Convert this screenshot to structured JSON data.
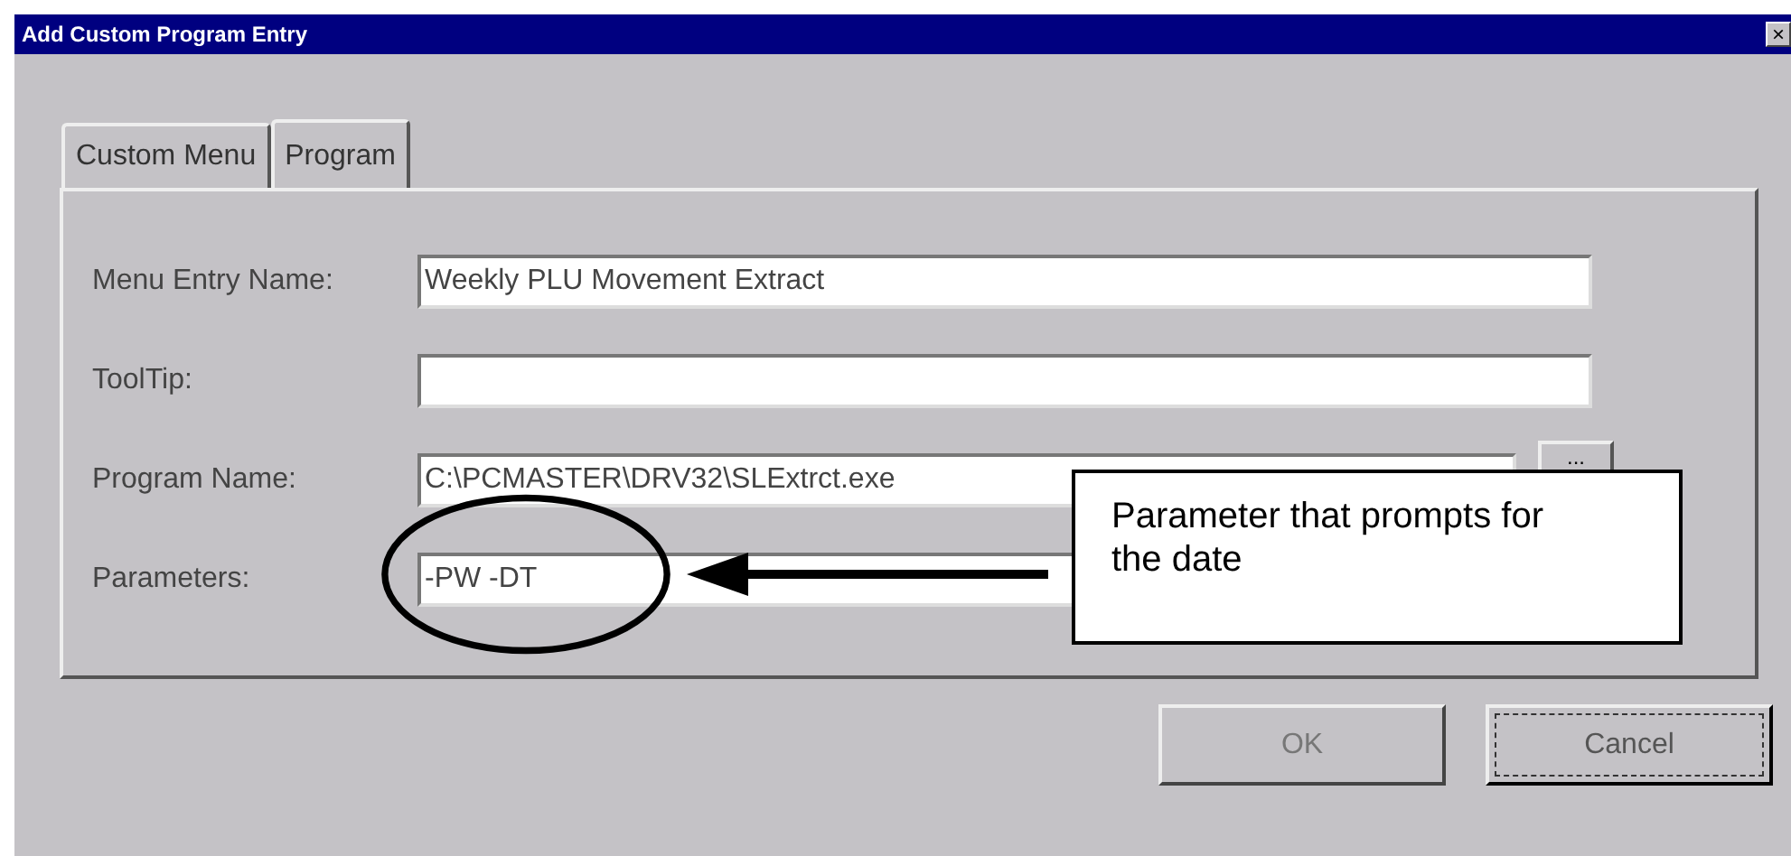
{
  "window": {
    "title": "Add Custom Program Entry",
    "close": "×"
  },
  "tabs": [
    {
      "label": "Custom Menu",
      "selected": false
    },
    {
      "label": "Program",
      "selected": true
    }
  ],
  "fields": [
    {
      "label": "Menu Entry Name:",
      "value": "Weekly PLU Movement Extract"
    },
    {
      "label": "ToolTip:"
    },
    {
      "label": "Program  Name:",
      "value": "C:\\PCMASTER\\DRV32\\SLExtrct.exe",
      "browse": "..."
    },
    {
      "label": "Parameters:",
      "value": "-PW -DT"
    }
  ],
  "callout": {
    "text": "Parameter that prompts for the date"
  },
  "buttons": [
    {
      "label": "OK",
      "disabled": true
    },
    {
      "label": "Cancel",
      "disabled": false
    }
  ]
}
